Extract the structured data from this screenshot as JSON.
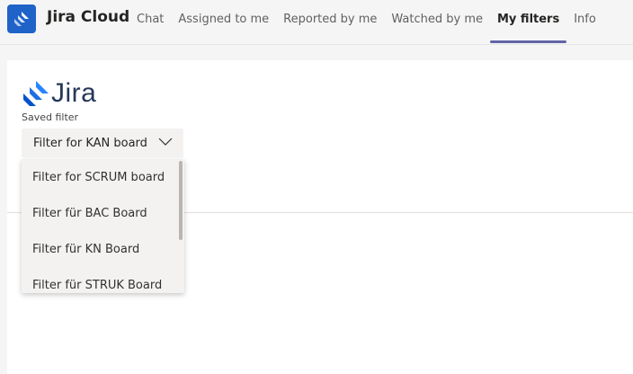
{
  "app": {
    "title": "Jira Cloud",
    "icon": "jira-app-icon",
    "brand_color": "#1f63c8"
  },
  "tabs": [
    {
      "label": "Chat",
      "active": false
    },
    {
      "label": "Assigned to me",
      "active": false
    },
    {
      "label": "Reported by me",
      "active": false
    },
    {
      "label": "Watched by me",
      "active": false
    },
    {
      "label": "My filters",
      "active": true
    },
    {
      "label": "Info",
      "active": false
    }
  ],
  "content": {
    "logo_text": "Jira",
    "saved_filter_label": "Saved filter",
    "selected_filter": "Filter for KAN board",
    "dropdown_options": [
      "Filter for SCRUM board",
      "Filter für BAC Board",
      "Filter für KN Board",
      "Filter für STRUK Board"
    ]
  },
  "colors": {
    "accent": "#6264a7",
    "jira_blue": "#2684ff",
    "jira_text": "#253858"
  }
}
